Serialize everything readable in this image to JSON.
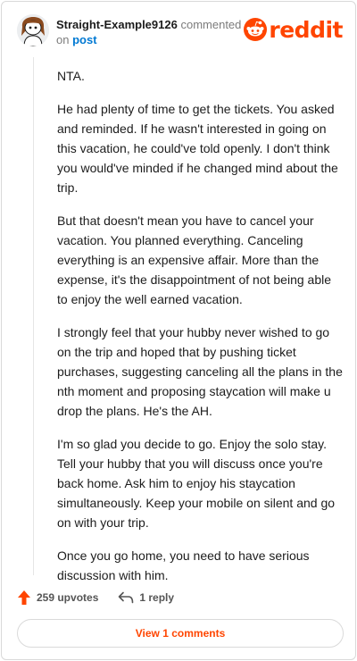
{
  "header": {
    "username": "Straight-Example9126",
    "action_text": "commented",
    "on_text": "on",
    "post_link": "post",
    "brand": "reddit"
  },
  "comment": {
    "paragraphs": [
      "NTA.",
      "He had plenty of time to get the tickets. You asked and reminded. If he wasn't interested in going on this vacation, he could've told openly. I don't think you would've minded if he changed mind about the trip.",
      "But that doesn't mean you have to cancel your vacation. You planned everything. Canceling everything is an expensive affair. More than the expense, it's the disappointment of not being able to enjoy the well earned vacation.",
      "I strongly feel that your hubby never wished to go on the trip and hoped that by pushing ticket purchases, suggesting canceling all the plans in the nth moment and proposing staycation will make u drop the plans. He's the AH.",
      "I'm so glad you decide to go. Enjoy the solo stay. Tell your hubby that you will discuss once you're back home. Ask him to enjoy his staycation simultaneously. Keep your mobile on silent and go on with your trip.",
      "Once you go home, you need to have serious discussion with him."
    ]
  },
  "actions": {
    "upvotes": "259 upvotes",
    "replies": "1 reply"
  },
  "footer": {
    "view_button": "View 1 comments"
  },
  "colors": {
    "brand": "#ff4500",
    "link": "#0079d3",
    "muted": "#7c7c7c"
  },
  "icons": [
    "avatar-snoo",
    "reddit-logo-icon",
    "upvote-arrow-icon",
    "reply-arrow-icon"
  ]
}
